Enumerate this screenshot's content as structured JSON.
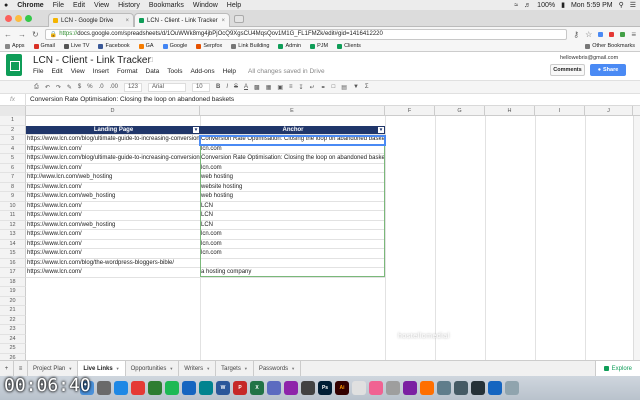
{
  "mac_menubar": {
    "apple": "",
    "items": [
      "Chrome",
      "File",
      "Edit",
      "View",
      "History",
      "Bookmarks",
      "Window",
      "Help"
    ],
    "battery": "100%",
    "clock": "Mon 5:59 PM"
  },
  "browser": {
    "tabs": [
      {
        "label": "LCN - Google Drive"
      },
      {
        "label": "LCN - Client - Link Tracker"
      }
    ],
    "url_scheme": "https://",
    "url_rest": "docs.google.com/spreadsheets/d/1OuWWk8mg4jbPjOcQ9XgsCU4MqsQov1M1G_FL1FMZk/edit#gid=1416412220",
    "bookmarks": [
      "Apps",
      "Gmail",
      "Live TV",
      "Facebook",
      "GA",
      "Google",
      "Serpfox",
      "Link Building",
      "Admin",
      "PJM",
      "Clients"
    ],
    "other_bookmarks": "Other Bookmarks"
  },
  "doc": {
    "title": "LCN - Client - Link Tracker",
    "menu": [
      "File",
      "Edit",
      "View",
      "Insert",
      "Format",
      "Data",
      "Tools",
      "Add-ons",
      "Help"
    ],
    "saved_status": "All changes saved in Drive",
    "user_email": "hellowebris@gmail.com",
    "comments_label": "Comments",
    "share_label": "Share"
  },
  "toolbar": {
    "zoom_format": "123",
    "font": "Arial",
    "font_size": "10"
  },
  "formula_bar": {
    "fx": "fx",
    "value": "Conversion Rate Optimisation: Closing the loop on abandoned baskets"
  },
  "grid": {
    "columns": [
      "D",
      "E",
      "F",
      "G",
      "H",
      "I",
      "J"
    ],
    "row_numbers": [
      "1",
      "2",
      "3",
      "4",
      "5",
      "6",
      "7",
      "8",
      "9",
      "10",
      "11",
      "12",
      "13",
      "14",
      "15",
      "16",
      "17",
      "18",
      "19",
      "20",
      "21",
      "22",
      "23",
      "24",
      "25",
      "26"
    ],
    "header": {
      "landing_page": "Landing Page",
      "anchor": "Anchor"
    },
    "rows": [
      {
        "landing": "https://www.lcn.com/blog/ultimate-guide-to-increasing-conversions/",
        "anchor": "Conversion Rate Optimisation: Closing the loop on abandoned baskets"
      },
      {
        "landing": "https://www.lcn.com/",
        "anchor": "lcn.com"
      },
      {
        "landing": "https://www.lcn.com/blog/ultimate-guide-to-increasing-conversions/",
        "anchor": "Conversion Rate Optimisation: Closing the loop on abandoned baskets"
      },
      {
        "landing": "https://www.lcn.com/",
        "anchor": "lcn.com"
      },
      {
        "landing": "http://www.lcn.com/web_hosting",
        "anchor": "web hosting"
      },
      {
        "landing": "https://www.lcn.com/",
        "anchor": "website hosting"
      },
      {
        "landing": "https://www.lcn.com/web_hosting",
        "anchor": "web hosting"
      },
      {
        "landing": "https://www.lcn.com/",
        "anchor": "LCN"
      },
      {
        "landing": "https://www.lcn.com/",
        "anchor": "LCN"
      },
      {
        "landing": "https://www.lcn.com/web_hosting",
        "anchor": "LCN"
      },
      {
        "landing": "https://www.lcn.com/",
        "anchor": "lcn.com"
      },
      {
        "landing": "https://www.lcn.com/",
        "anchor": "lcn.com"
      },
      {
        "landing": "https://www.lcn.com/",
        "anchor": "lcn.com"
      },
      {
        "landing": "https://www.lcn.com/blog/the-wordpress-bloggers-bible/",
        "anchor": ""
      },
      {
        "landing": "https://www.lcn.com/",
        "anchor": "a hosting company"
      }
    ]
  },
  "watermark": "hostellomedial",
  "sheet_tabs": [
    {
      "label": "Project Plan",
      "active": false
    },
    {
      "label": "Live Links",
      "active": true
    },
    {
      "label": "Opportunities",
      "active": false
    },
    {
      "label": "Writers",
      "active": false
    },
    {
      "label": "Targets",
      "active": false
    },
    {
      "label": "Passwords",
      "active": false
    }
  ],
  "explore_label": "Explore",
  "timer": "00:06:40",
  "colors": {
    "header_fill": "#20366a",
    "sheets_green": "#0f9d58",
    "share_blue": "#4a8af4"
  }
}
